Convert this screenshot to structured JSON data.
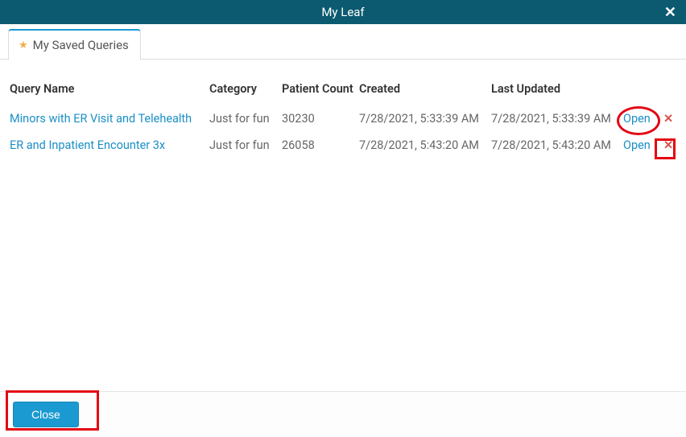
{
  "titlebar": {
    "title": "My Leaf"
  },
  "tab": {
    "label": "My Saved Queries"
  },
  "columns": {
    "name": "Query Name",
    "category": "Category",
    "patient_count": "Patient Count",
    "created": "Created",
    "last_updated": "Last Updated"
  },
  "rows": [
    {
      "name": "Minors with ER Visit and Telehealth",
      "category": "Just for fun",
      "patient_count": "30230",
      "created": "7/28/2021, 5:33:39 AM",
      "last_updated": "7/28/2021, 5:33:39 AM",
      "open": "Open"
    },
    {
      "name": "ER and Inpatient Encounter 3x",
      "category": "Just for fun",
      "patient_count": "26058",
      "created": "7/28/2021, 5:43:20 AM",
      "last_updated": "7/28/2021, 5:43:20 AM",
      "open": "Open"
    }
  ],
  "footer": {
    "close": "Close"
  }
}
